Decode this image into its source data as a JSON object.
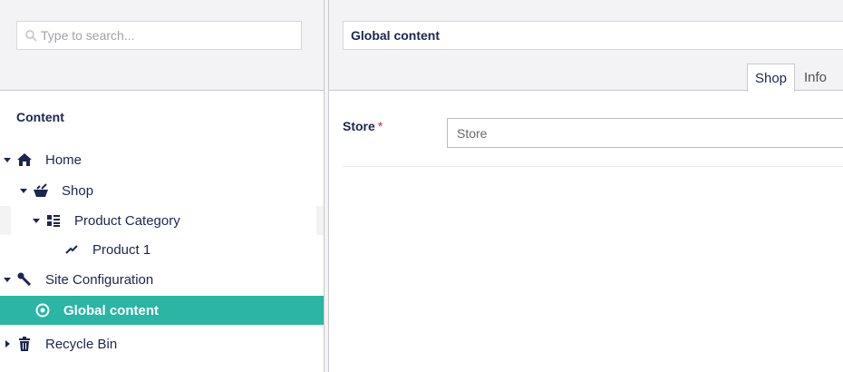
{
  "search": {
    "placeholder": "Type to search..."
  },
  "tree": {
    "section_title": "Content",
    "items": [
      {
        "label": "Home",
        "icon": "home-icon",
        "expanded": true
      },
      {
        "label": "Shop",
        "icon": "shop-icon",
        "expanded": true
      },
      {
        "label": "Product Category",
        "icon": "list-icon",
        "expanded": true
      },
      {
        "label": "Product 1",
        "icon": "product-icon"
      },
      {
        "label": "Site Configuration",
        "icon": "wrench-icon",
        "expanded": true
      },
      {
        "label": "Global content",
        "icon": "target-icon",
        "selected": true
      },
      {
        "label": "Recycle Bin",
        "icon": "trash-icon",
        "expanded": false
      }
    ]
  },
  "editor": {
    "name": "Global content",
    "tabs": [
      {
        "label": "Shop",
        "active": true
      },
      {
        "label": "Info",
        "active": false
      }
    ],
    "properties": [
      {
        "label": "Store",
        "required_mark": "*",
        "value": "Store"
      }
    ]
  },
  "colors": {
    "accent": "#2bb5a3",
    "text": "#1b264f",
    "required": "#d42054"
  }
}
